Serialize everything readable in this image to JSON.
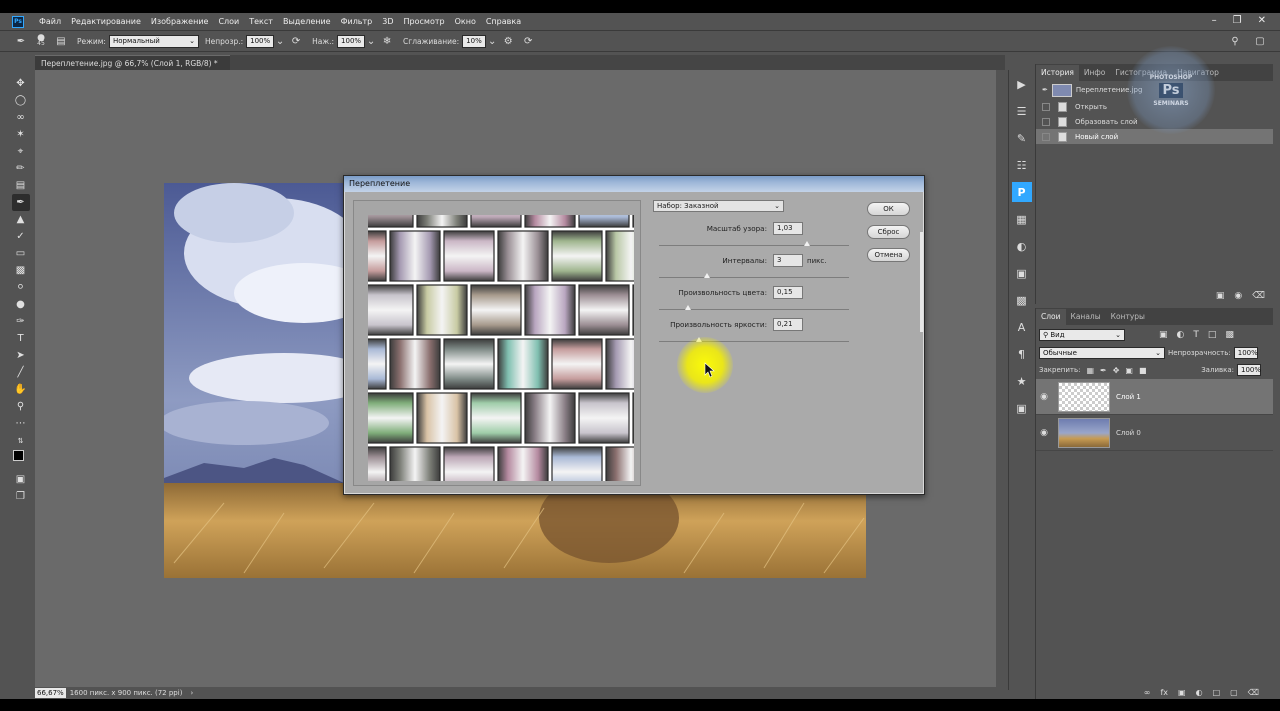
{
  "menu": [
    "Файл",
    "Редактирование",
    "Изображение",
    "Слои",
    "Текст",
    "Выделение",
    "Фильтр",
    "3D",
    "Просмотр",
    "Окно",
    "Справка"
  ],
  "options": {
    "brush_size": "45",
    "mode_label": "Режим:",
    "mode_value": "Нормальный",
    "opacity_label": "Непрозр.:",
    "opacity_value": "100%",
    "flow_label": "Наж.:",
    "flow_value": "100%",
    "smoothing_label": "Сглаживание:",
    "smoothing_value": "10%"
  },
  "document_tab": "Переплетение.jpg @ 66,7% (Слой 1, RGB/8) *",
  "status": {
    "zoom": "66,67%",
    "info": "1600 пикс. x 900 пикс. (72 ppi)"
  },
  "dialog": {
    "title": "Переплетение",
    "preset": "Набор: Заказной",
    "params": [
      {
        "label": "Масштаб узора:",
        "value": "1,03",
        "unit": "",
        "level": 0.78
      },
      {
        "label": "Интервалы:",
        "value": "3",
        "unit": "пикс.",
        "level": 0.25
      },
      {
        "label": "Произвольность цвета:",
        "value": "0,15",
        "unit": "",
        "level": 0.15
      },
      {
        "label": "Произвольность яркости:",
        "value": "0,21",
        "unit": "",
        "level": 0.21
      }
    ],
    "ok": "ОК",
    "reset": "Сброс",
    "cancel": "Отмена"
  },
  "history_panel": {
    "tabs": [
      "История",
      "Инфо",
      "Гистограмма",
      "Навигатор"
    ],
    "snapshot": "Переплетение.jpg",
    "items": [
      "Открыть",
      "Образовать слой",
      "Новый слой"
    ]
  },
  "layers_panel": {
    "tabs": [
      "Слои",
      "Каналы",
      "Контуры"
    ],
    "filter": "Вид",
    "blend": "Обычные",
    "opacity_label": "Непрозрачность:",
    "opacity": "100%",
    "lock_label": "Закрепить:",
    "fill_label": "Заливка:",
    "fill": "100%",
    "layers": [
      "Слой 1",
      "Слой 0"
    ]
  },
  "watermark": {
    "line1": "PHOTOSHOP",
    "line2": "Ps",
    "line3": "SEMINARS"
  },
  "colors": {
    "accent": "#31a8ff",
    "highlight": "#ffff00"
  }
}
